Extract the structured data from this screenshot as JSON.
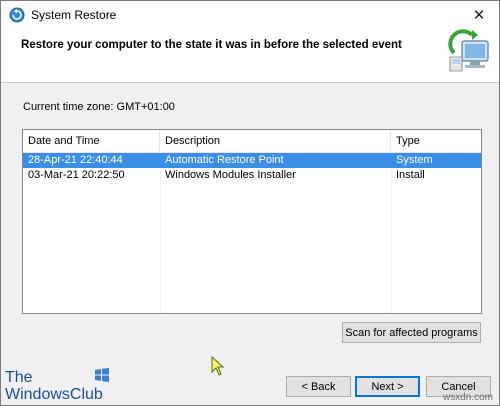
{
  "window": {
    "title": "System Restore",
    "close_glyph": "✕"
  },
  "header": {
    "title": "Restore your computer to the state it was in before the selected event"
  },
  "timezone": {
    "label": "Current time zone: GMT+01:00"
  },
  "restore_list": {
    "columns": [
      "Date and Time",
      "Description",
      "Type"
    ],
    "rows": [
      {
        "date": "28-Apr-21 22:40:44",
        "description": "Automatic Restore Point",
        "type": "System",
        "selected": true
      },
      {
        "date": "03-Mar-21 20:22:50",
        "description": "Windows Modules Installer",
        "type": "Install",
        "selected": false
      }
    ]
  },
  "buttons": {
    "scan": "Scan for affected programs",
    "back": "< Back",
    "next": "Next >",
    "cancel": "Cancel"
  },
  "branding": {
    "logo_line1": "The",
    "logo_line2": "WindowsClub",
    "watermark": "wsxdn.com"
  },
  "icons": {
    "app": "system-restore-icon",
    "header": "restore-computer-icon",
    "cursor": "mouse-pointer-icon"
  },
  "colors": {
    "selection": "#3a8ee6",
    "accent": "#0078d7"
  }
}
